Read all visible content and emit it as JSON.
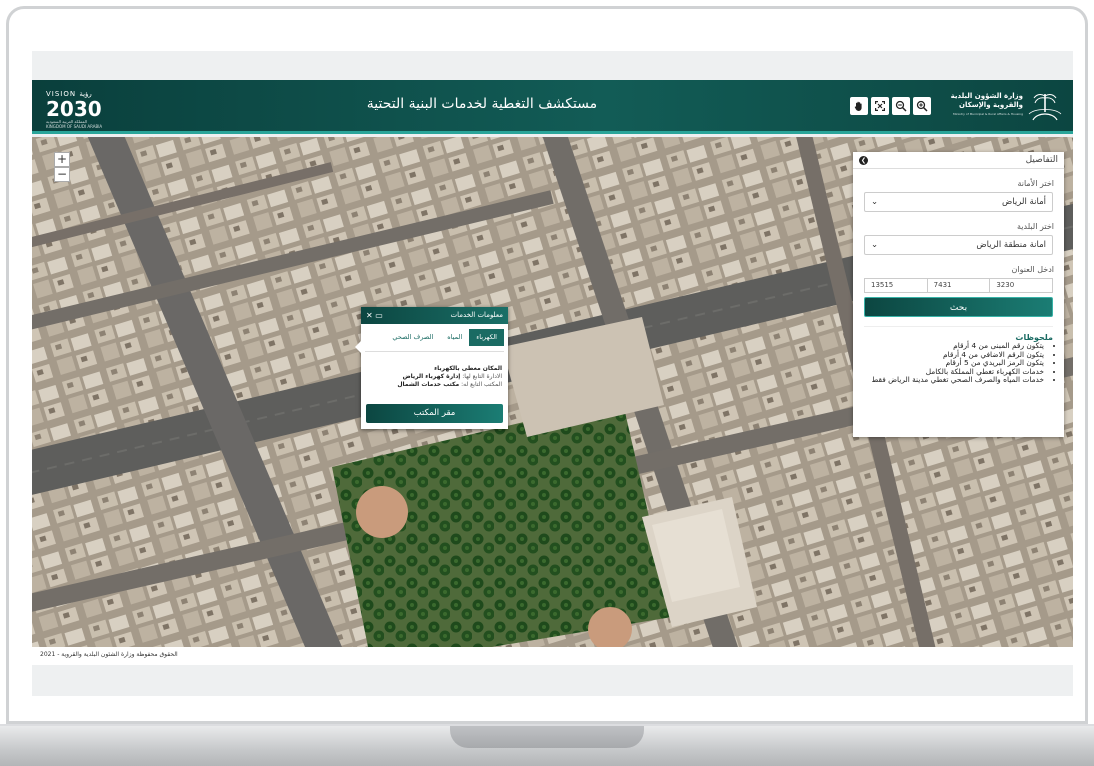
{
  "header": {
    "title": "مستكشف التغطية لخدمات البنية التحتية",
    "vision_top": "VISION رؤية",
    "vision_year": "2030",
    "vision_sub": "المملكة العربية السعودية KINGDOM OF SAUDI ARABIA",
    "ministry_line1": "وزارة الشؤون البلدية",
    "ministry_line2": "والقروية والإسكان",
    "ministry_line3": "Ministry of Municipal & Rural Affairs & Housing",
    "tools": [
      "pan-icon",
      "fullscreen-icon",
      "zoom-out-icon",
      "zoom-in-icon"
    ]
  },
  "map": {
    "zoom_in": "+",
    "zoom_out": "−"
  },
  "panel": {
    "title": "التفاصيل",
    "amana_label": "اختر الأمانة",
    "amana_value": "أمانة الرياض",
    "baladiya_label": "اختر البلدية",
    "baladiya_value": "امانة منطقة الرياض",
    "address_label": "ادخل العنوان",
    "address_fields": [
      "3230",
      "7431",
      "13515"
    ],
    "search_label": "بحث",
    "notes_title": "ملحوظات",
    "notes": [
      "يتكون رقم المبنى من 4 أرقام",
      "يتكون الرقم الاضافي من 4 أرقام",
      "يتكون الرمز البريدي من 5 أرقام",
      "خدمات الكهرباء تغطي المملكة بالكامل",
      "خدمات المياه والصرف الصحي تغطي مدينة الرياض فقط"
    ]
  },
  "popup": {
    "title": "معلومات الخدمات",
    "controls": "✕ ▭",
    "tabs": [
      "الكهرباء",
      "المياه",
      "الصرف الصحي"
    ],
    "status": "المكان مغطى بالكهرباء",
    "admin_label": "الادارة التابع لها:",
    "admin_value": "إدارة كهرباء الرياض",
    "office_label": "المكتب التابع له:",
    "office_value": "مكتب خدمات الشمال",
    "office_button": "مقر المكتب"
  },
  "footer": {
    "copyright": "الحقوق محفوظة وزارة الشئون البلدية والقروية - 2021"
  },
  "colors": {
    "header_dark": "#0a3f3c",
    "header_mid": "#125c56",
    "accent": "#2aa59a",
    "button": "#1b7d74"
  }
}
